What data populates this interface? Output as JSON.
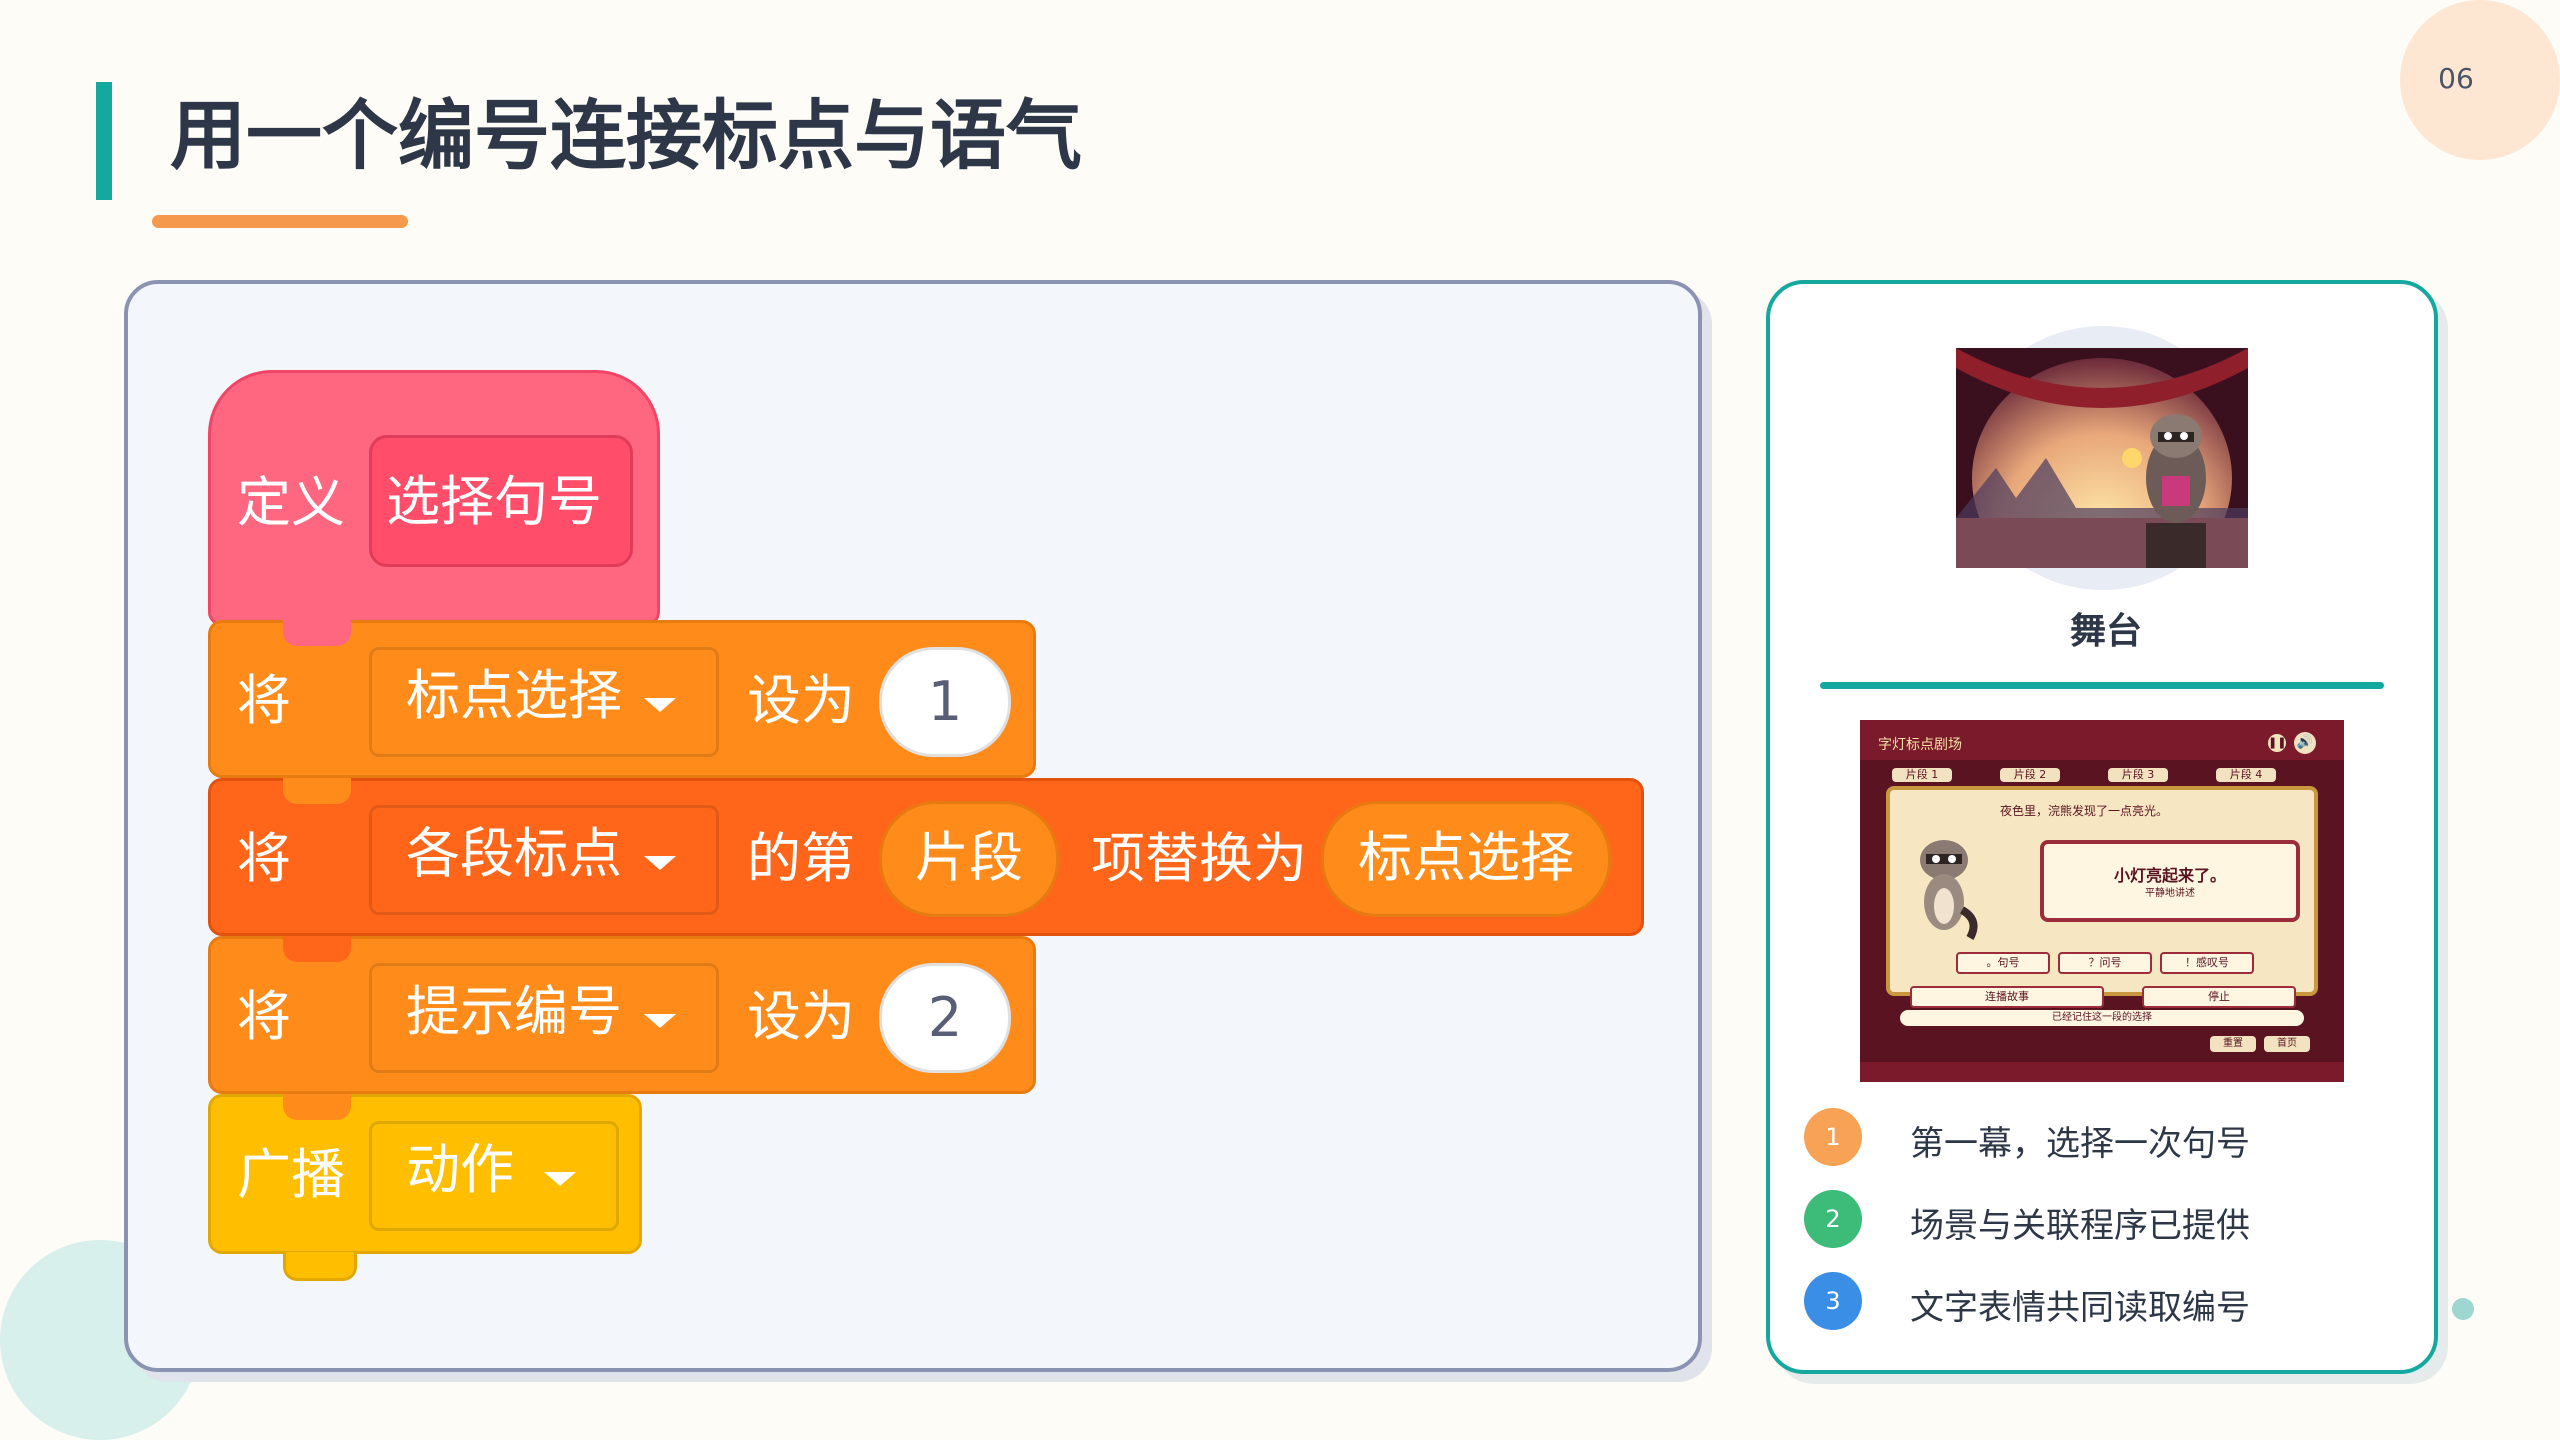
{
  "page": {
    "number": "06",
    "title": "用一个编号连接标点与语气"
  },
  "colors": {
    "accent_teal": "#14a89e",
    "accent_orange": "#f59a4c",
    "event_pink": "#ff6680",
    "variable_orange": "#ff8c1a",
    "list_orange": "#ff661a",
    "broadcast_yellow": "#ffbf00"
  },
  "code": {
    "define_block": {
      "keyword": "定义",
      "name": "选择句号"
    },
    "set_punct": {
      "verb": "将",
      "variable": "标点选择",
      "to_label": "设为",
      "value": "1"
    },
    "replace_item": {
      "verb": "将",
      "list": "各段标点",
      "of_label": "的第",
      "index": "片段",
      "replace_label": "项替换为",
      "value": "标点选择"
    },
    "set_hint": {
      "verb": "将",
      "variable": "提示编号",
      "to_label": "设为",
      "value": "2"
    },
    "broadcast": {
      "keyword": "广播",
      "message": "动作"
    }
  },
  "side": {
    "stage_label": "舞台",
    "stage_thumb_icon": "raccoon-lantern-scene",
    "game_screen": {
      "title": "字灯标点剧场",
      "tabs": [
        "片段 1",
        "片段 2",
        "片段 3",
        "片段 4"
      ],
      "story_line": "夜色里，浣熊发现了一点亮光。",
      "sentence": "小灯亮起来了。",
      "tone": "平静地讲述",
      "options": [
        "。句号",
        "？问号",
        "！感叹号"
      ],
      "controls": [
        "连播故事",
        "停止"
      ],
      "status": "已经记住这一段的选择",
      "nav": [
        "重置",
        "首页"
      ]
    },
    "steps": [
      {
        "num": "1",
        "text": "第一幕，选择一次句号",
        "color": "#f7a254"
      },
      {
        "num": "2",
        "text": "场景与关联程序已提供",
        "color": "#3dbb78"
      },
      {
        "num": "3",
        "text": "文字表情共同读取编号",
        "color": "#3b8ee6"
      }
    ]
  }
}
